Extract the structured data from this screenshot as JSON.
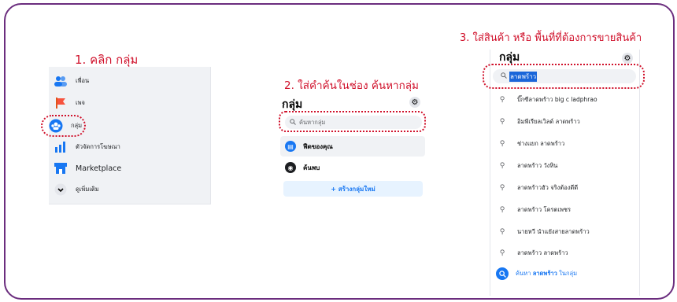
{
  "steps": {
    "step1": "1. คลิก กลุ่ม",
    "step2": "2. ใส่คำค้นในช่อง ค้นหากลุ่ม",
    "step3": "3. ใส่สินค้า หรือ พื้นที่ที่ต้องการขายสินค้า"
  },
  "sidebar": {
    "items": [
      {
        "label": "เพื่อน",
        "icon": "friends-icon"
      },
      {
        "label": "เพจ",
        "icon": "flag-icon"
      },
      {
        "label": "กลุ่ม",
        "icon": "groups-icon"
      },
      {
        "label": "ตัวจัดการโฆษณา",
        "icon": "ads-manager-icon"
      },
      {
        "label": "Marketplace",
        "icon": "marketplace-icon"
      },
      {
        "label": "ดูเพิ่มเติม",
        "icon": "chevron-down-icon"
      }
    ]
  },
  "groups_panel": {
    "title": "กลุ่ม",
    "search_placeholder": "ค้นหากลุ่ม",
    "rows": [
      {
        "label": "ฟีดของคุณ",
        "icon": "feed-icon"
      },
      {
        "label": "ค้นพบ",
        "icon": "discover-icon"
      }
    ],
    "create_button": "+ สร้างกลุ่มใหม่"
  },
  "results_panel": {
    "title": "กลุ่ม",
    "search_value": "ลาดพร้าว",
    "results": [
      "บิ๊กซีลาดพร้าว big c ladphrao",
      "อิมพีเรียลเวิลด์ ลาดพร้าว",
      "ช่างแยก ลาดพร้าว",
      "ลาดพร้าว วังหิน",
      "ลาดพร้าวฮัว จริงต้องดีดี",
      "ลาดพร้าว โครตเพชร",
      "นายหวี นำแยังสายลาดพร้าว",
      "ลาดพร้าว ลาดพร้าว"
    ],
    "footer_prefix": "ค้นหา",
    "footer_term": "ลาดพร้าว",
    "footer_suffix": "ในกลุ่ม"
  },
  "colors": {
    "frame": "#6b2d7e",
    "highlight": "#d0112b",
    "accent": "#1877f2"
  }
}
